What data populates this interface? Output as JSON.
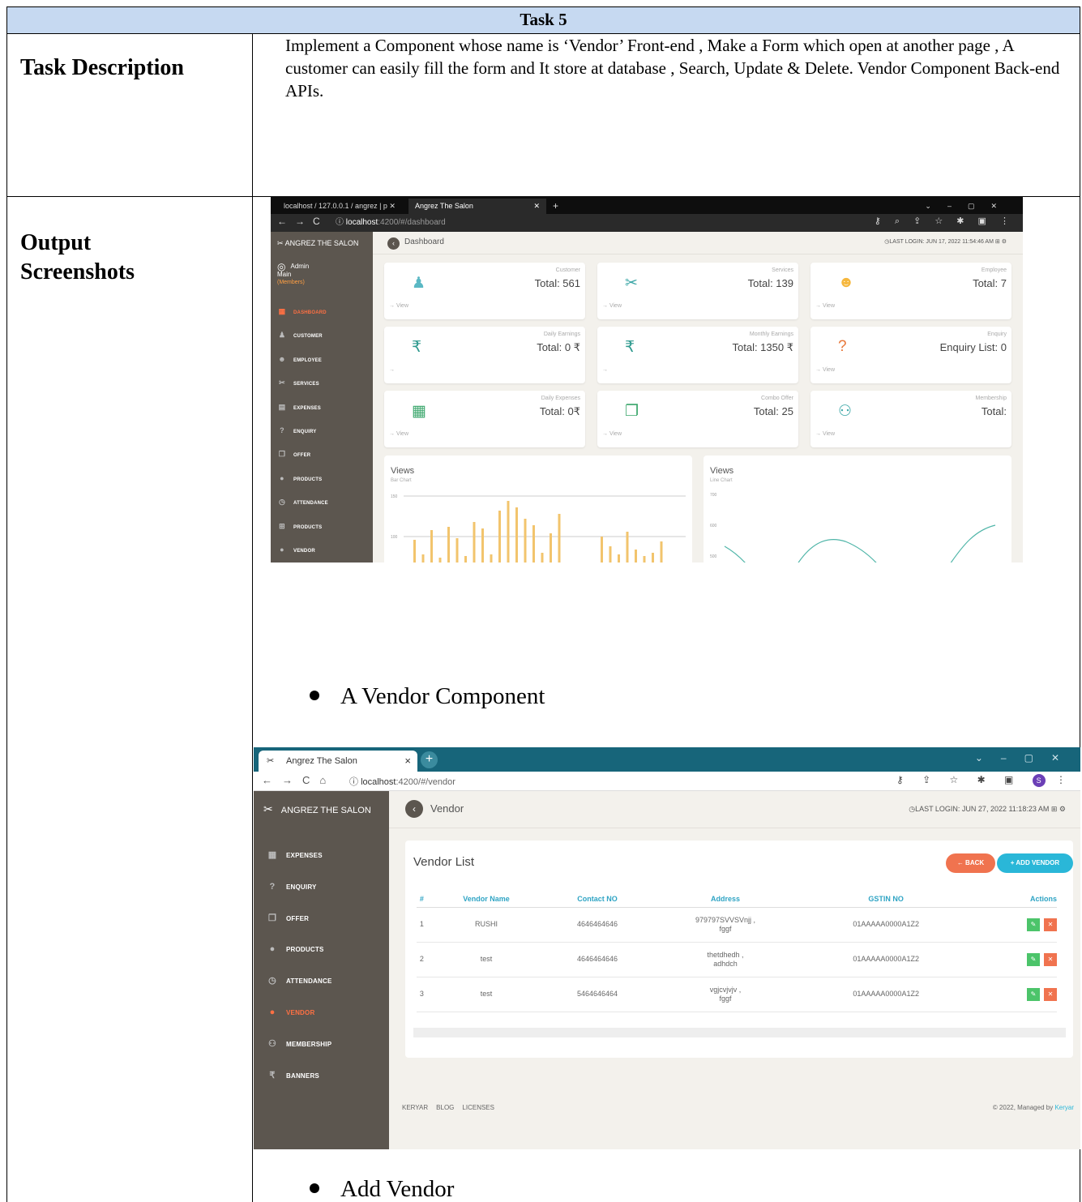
{
  "doc": {
    "title": "Task 5",
    "desc_label": "Task Description",
    "desc_text": "Implement a Component whose name is ‘Vendor’ Front-end , Make a Form which open at another page , A customer can easily fill the form and It store at database , Search, Update & Delete. Vendor Component Back-end APIs.",
    "output_label": "Output Screenshots",
    "bullet1": "A Vendor Component",
    "bullet2": "Add Vendor"
  },
  "shot1": {
    "tab1": "localhost / 127.0.0.1 / angrez | p",
    "tab2": "Angrez The Salon",
    "url_host": "localhost",
    "url_path": ":4200/#/dashboard",
    "brand": "ANGREZ THE SALON",
    "admin_name": "Admin Main",
    "admin_sub": "(Members)",
    "page_title": "Dashboard",
    "last_login": "LAST LOGIN: JUN 17, 2022 11:54:46 AM",
    "menu": [
      {
        "label": "DASHBOARD",
        "icon": "dashboard-icon",
        "glyph": "▦"
      },
      {
        "label": "CUSTOMER",
        "icon": "customer-icon",
        "glyph": "♟"
      },
      {
        "label": "EMPLOYEE",
        "icon": "employee-icon",
        "glyph": "☻"
      },
      {
        "label": "SERVICES",
        "icon": "scissors-icon",
        "glyph": "✂"
      },
      {
        "label": "EXPENSES",
        "icon": "calculator-icon",
        "glyph": "▤"
      },
      {
        "label": "ENQUIRY",
        "icon": "question-icon",
        "glyph": "?"
      },
      {
        "label": "OFFER",
        "icon": "gift-icon",
        "glyph": "❐"
      },
      {
        "label": "PRODUCTS",
        "icon": "product-icon",
        "glyph": "●"
      },
      {
        "label": "ATTENDANCE",
        "icon": "clock-icon",
        "glyph": "◷"
      },
      {
        "label": "PRODUCTS",
        "icon": "cart-icon",
        "glyph": "⊞"
      },
      {
        "label": "VENDOR",
        "icon": "vendor-icon",
        "glyph": "●"
      }
    ],
    "cards": [
      {
        "label": "Customer",
        "value": "Total: 561",
        "link": "View",
        "icon": "user-icon",
        "glyph": "♟",
        "color": "#5bb8c4"
      },
      {
        "label": "Services",
        "value": "Total: 139",
        "link": "View",
        "icon": "scissors-icon",
        "glyph": "✂",
        "color": "#3aa6a6"
      },
      {
        "label": "Employee",
        "value": "Total: 7",
        "link": "View",
        "icon": "group-icon",
        "glyph": "☻",
        "color": "#f6b73c"
      },
      {
        "label": "Daily Earnings",
        "value": "Total: 0 ₹",
        "link": "",
        "icon": "rupee-icon",
        "glyph": "₹",
        "color": "#2f9a8f"
      },
      {
        "label": "Monthly Earnings",
        "value": "Total: 1350 ₹",
        "link": "",
        "icon": "rupee-icon",
        "glyph": "₹",
        "color": "#2f9a8f"
      },
      {
        "label": "Enquiry",
        "value": "Enquiry List: 0",
        "link": "View",
        "icon": "question-icon",
        "glyph": "?",
        "color": "#e8793c"
      },
      {
        "label": "Daily Expenses",
        "value": "Total: 0₹",
        "link": "View",
        "icon": "calculator-icon",
        "glyph": "▦",
        "color": "#3aa66b"
      },
      {
        "label": "Combo Offer",
        "value": "Total: 25",
        "link": "View",
        "icon": "gift-icon",
        "glyph": "❐",
        "color": "#3aa66b"
      },
      {
        "label": "Membership",
        "value": "Total:",
        "link": "View",
        "icon": "handshake-icon",
        "glyph": "⚇",
        "color": "#3aa6a6"
      }
    ],
    "chart1_title": "Views",
    "chart1_sub": "Bar Chart",
    "chart2_title": "Views",
    "chart2_sub": "Line Chart",
    "chart1_ticks": [
      "150",
      "100"
    ],
    "chart2_ticks": [
      "700",
      "600",
      "500"
    ]
  },
  "shot2": {
    "tab": "Angrez The Salon",
    "url_host": "localhost",
    "url_path": ":4200/#/vendor",
    "brand": "ANGREZ THE SALON",
    "page_title": "Vendor",
    "last_login": "LAST LOGIN: JUN 27, 2022 11:18:23 AM",
    "menu": [
      {
        "label": "EXPENSES",
        "icon": "calculator-icon",
        "glyph": "▦"
      },
      {
        "label": "ENQUIRY",
        "icon": "question-icon",
        "glyph": "?"
      },
      {
        "label": "OFFER",
        "icon": "gift-icon",
        "glyph": "❐"
      },
      {
        "label": "PRODUCTS",
        "icon": "product-icon",
        "glyph": "●"
      },
      {
        "label": "ATTENDANCE",
        "icon": "clock-icon",
        "glyph": "◷"
      },
      {
        "label": "VENDOR",
        "icon": "vendor-icon",
        "glyph": "●"
      },
      {
        "label": "MEMBERSHIP",
        "icon": "handshake-icon",
        "glyph": "⚇"
      },
      {
        "label": "BANNERS",
        "icon": "rupee-icon",
        "glyph": "₹"
      }
    ],
    "list_title": "Vendor List",
    "back_btn": "← BACK",
    "add_btn": "+ ADD VENDOR",
    "columns": [
      "#",
      "Vendor Name",
      "Contact NO",
      "Address",
      "GSTIN NO",
      "Actions"
    ],
    "rows": [
      {
        "num": "1",
        "name": "RUSHI",
        "contact": "4646464646",
        "addr1": "979797SVVSVnjj ,",
        "addr2": "fggf",
        "gstin": "01AAAAA0000A1Z2"
      },
      {
        "num": "2",
        "name": "test",
        "contact": "4646464646",
        "addr1": "thetdhedh ,",
        "addr2": "adhdch",
        "gstin": "01AAAAA0000A1Z2"
      },
      {
        "num": "3",
        "name": "test",
        "contact": "5464646464",
        "addr1": "vgjcvjvjv ,",
        "addr2": "fggf",
        "gstin": "01AAAAA0000A1Z2"
      }
    ],
    "footer_links": [
      "KERYAR",
      "BLOG",
      "LICENSES"
    ],
    "footer_copy": "© 2022, Managed by ",
    "footer_brand": "Keryar"
  }
}
